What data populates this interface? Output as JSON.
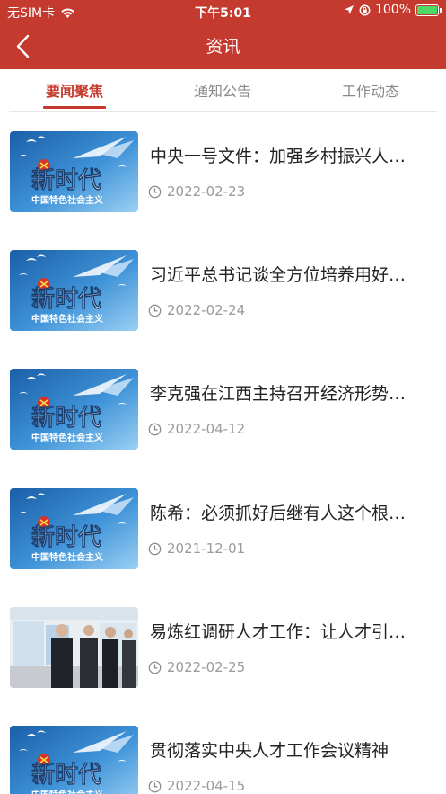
{
  "status_bar": {
    "carrier": "无SIM卡",
    "time": "下午5:01",
    "battery": "100%"
  },
  "navbar": {
    "title": "资讯",
    "back_icon": "chevron-left-icon"
  },
  "tabs": [
    {
      "label": "要闻聚焦",
      "active": true
    },
    {
      "label": "通知公告",
      "active": false
    },
    {
      "label": "工作动态",
      "active": false
    }
  ],
  "news": [
    {
      "title": "中央一号文件：加强乡村振兴人才队伍建设",
      "date": "2022-02-23",
      "thumb": "banner",
      "thumb_text": "新时代",
      "thumb_subtext": "中国特色社会主义"
    },
    {
      "title": "习近平总书记谈全方位培养用好人才",
      "date": "2022-02-24",
      "thumb": "banner",
      "thumb_text": "新时代",
      "thumb_subtext": "中国特色社会主义"
    },
    {
      "title": "李克强在江西主持召开经济形势座谈会",
      "date": "2022-04-12",
      "thumb": "banner",
      "thumb_text": "新时代",
      "thumb_subtext": "中国特色社会主义"
    },
    {
      "title": "陈希：必须抓好后继有人这个根本大计",
      "date": "2021-12-01",
      "thumb": "banner",
      "thumb_text": "新时代",
      "thumb_subtext": "中国特色社会主义"
    },
    {
      "title": "易炼红调研人才工作：让人才引得进留得住",
      "date": "2022-02-25",
      "thumb": "photo",
      "thumb_text": "",
      "thumb_subtext": ""
    },
    {
      "title": "贯彻落实中央人才工作会议精神",
      "date": "2022-04-15",
      "thumb": "banner",
      "thumb_text": "新时代",
      "thumb_subtext": "中国特色社会主义"
    }
  ],
  "colors": {
    "brand": "#c53a2f",
    "text": "#222222",
    "muted": "#9a9a9a"
  }
}
